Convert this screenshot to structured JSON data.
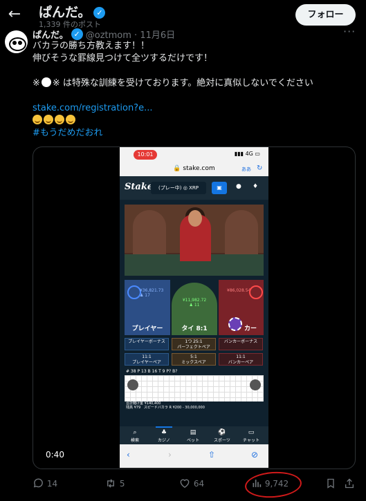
{
  "header": {
    "back_icon": "arrow-left-icon",
    "title": "ぱんだ。",
    "post_count": "1,339 件のポスト",
    "follow_label": "フォロー"
  },
  "post": {
    "display_name": "ぱんだ。",
    "handle_date": "@oztmom · 11月6日",
    "lines": [
      "バカラの勝ち方教えます！！",
      "伸びそうな罫線見つけて全ツするだけです！",
      "",
      "※ は特殊な訓練を受けております。絶対に真似しないでください",
      ""
    ],
    "link": "stake.com/registration?e...",
    "hashtag": "#もうだめだおれ",
    "video_duration": "0:40"
  },
  "video": {
    "status_time": "10:01",
    "status_signal": "4G",
    "url": "stake.com",
    "url_aa": "ああ",
    "brand": "Stake",
    "balance": "(プレー中) ◎ XRP",
    "player_amount": "¥36,821.73",
    "player_count": "17",
    "tie_amount": "¥11,982.72",
    "tie_count": "11",
    "banker_amount": "¥86,028.54",
    "player_label": "プレイヤー",
    "tie_label": "タイ 8:1",
    "banker_label": "カー",
    "side_bets": [
      "プレイヤーボーナス",
      "1つ 25:1\nパーフェクトペア",
      "バンカーボーナス",
      "11:1\nプレイヤーペア",
      "5:1\nミックスペア",
      "11:1\nバンカーペア"
    ],
    "road_stats": "# 38  P 13  B 16  T 9     P?      B?",
    "total_bet": "合計賭け金 ¥140,400",
    "limits": "スピードバカラ R  ¥200 - 30,000,000",
    "remaining": "残高 ¥79",
    "tabs": [
      "検索",
      "カジノ",
      "ベット",
      "スポーツ",
      "チャット"
    ]
  },
  "actions": {
    "replies": "14",
    "reposts": "5",
    "likes": "64",
    "views": "9,742"
  }
}
